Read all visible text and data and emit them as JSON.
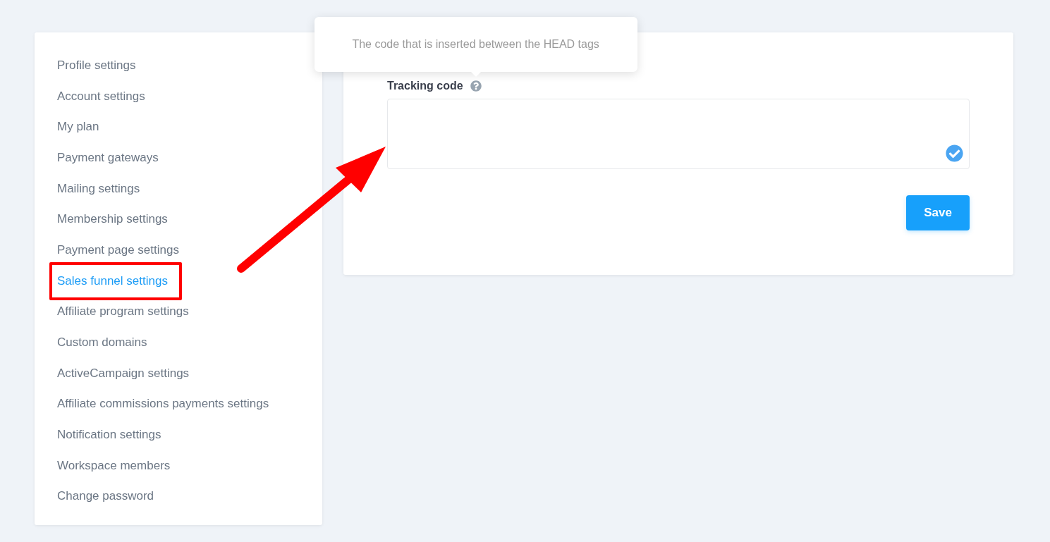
{
  "sidebar": {
    "items": [
      {
        "label": "Profile settings",
        "selected": false,
        "highlighted": false
      },
      {
        "label": "Account settings",
        "selected": false,
        "highlighted": false
      },
      {
        "label": "My plan",
        "selected": false,
        "highlighted": false
      },
      {
        "label": "Payment gateways",
        "selected": false,
        "highlighted": false
      },
      {
        "label": "Mailing settings",
        "selected": false,
        "highlighted": false
      },
      {
        "label": "Membership settings",
        "selected": false,
        "highlighted": false
      },
      {
        "label": "Payment page settings",
        "selected": false,
        "highlighted": false
      },
      {
        "label": "Sales funnel settings",
        "selected": true,
        "highlighted": true
      },
      {
        "label": "Affiliate program settings",
        "selected": false,
        "highlighted": false
      },
      {
        "label": "Custom domains",
        "selected": false,
        "highlighted": false
      },
      {
        "label": "ActiveCampaign settings",
        "selected": false,
        "highlighted": false
      },
      {
        "label": "Affiliate commissions payments settings",
        "selected": false,
        "highlighted": false
      },
      {
        "label": "Notification settings",
        "selected": false,
        "highlighted": false
      },
      {
        "label": "Workspace members",
        "selected": false,
        "highlighted": false
      },
      {
        "label": "Change password",
        "selected": false,
        "highlighted": false
      }
    ]
  },
  "form": {
    "field": {
      "label": "Tracking code",
      "tooltip": "The code that is inserted between the HEAD tags",
      "valid": true
    },
    "buttons": [
      {
        "label": "Save"
      }
    ]
  }
}
